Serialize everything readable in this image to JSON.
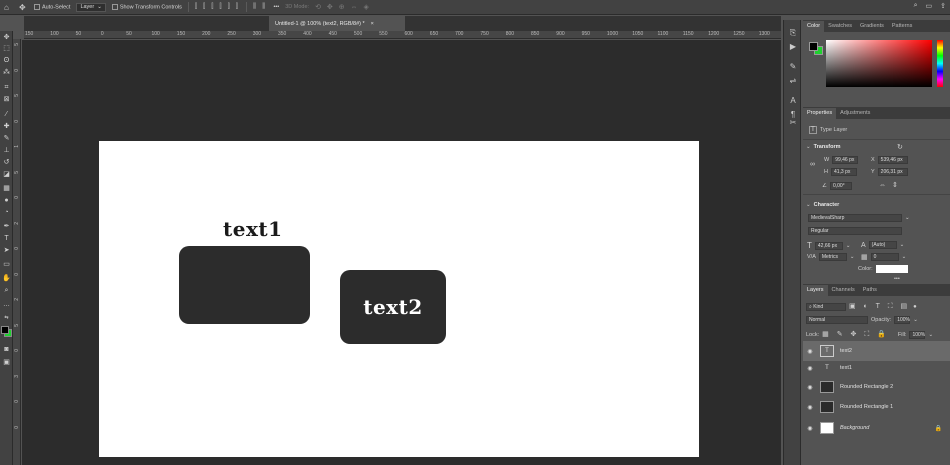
{
  "options_bar": {
    "auto_select_label": "Auto-Select",
    "target_value": "Layer",
    "transform_label": "Show Transform Controls",
    "mode_3d_label": "3D Mode:",
    "more": "•••"
  },
  "document_tab": {
    "title": "Untitled-1 @ 100% (text2, RGB/8#) *",
    "close": "×"
  },
  "ruler_h": [
    "150",
    "100",
    "50",
    "0",
    "50",
    "100",
    "150",
    "200",
    "250",
    "300",
    "350",
    "400",
    "450",
    "500",
    "550",
    "600",
    "650",
    "700",
    "750",
    "800",
    "850",
    "900",
    "950",
    "1000",
    "1050",
    "1100",
    "1150",
    "1200",
    "1250",
    "1300"
  ],
  "ruler_v": [
    "5",
    "0",
    "5",
    "0",
    "1",
    "5",
    "0",
    "2",
    "0",
    "0",
    "2",
    "5",
    "0",
    "3",
    "0",
    "0"
  ],
  "canvas": {
    "text1": "text1",
    "text2": "text2"
  },
  "color_panel": {
    "tabs": [
      "Color",
      "Swatches",
      "Gradients",
      "Patterns"
    ],
    "foreground": "#000000",
    "background": "#1fd12f"
  },
  "properties_panel": {
    "tabs": [
      "Properties",
      "Adjustments"
    ],
    "layer_kind": "Type Layer",
    "transform_title": "Transform",
    "w_label": "W",
    "w_value": "99,46 px",
    "x_label": "X",
    "x_value": "539,46 px",
    "h_label": "H",
    "h_value": "41,3 px",
    "y_label": "Y",
    "y_value": "206,31 px",
    "angle_value": "0,00°",
    "character_title": "Character",
    "font_family": "MedievalSharp",
    "font_style": "Regular",
    "font_size": "42,66 px",
    "leading": "(Auto)",
    "kerning": "Metrics",
    "tracking": "0",
    "color_label": "Color:",
    "more": "•••"
  },
  "layers_panel": {
    "tabs": [
      "Layers",
      "Channels",
      "Paths"
    ],
    "filter_kind": "Kind",
    "blend_mode": "Normal",
    "opacity_label": "Opacity:",
    "opacity_value": "100%",
    "lock_label": "Lock:",
    "fill_label": "Fill:",
    "fill_value": "100%",
    "layers": [
      {
        "name": "text2",
        "type": "text"
      },
      {
        "name": "text1",
        "type": "text"
      },
      {
        "name": "Rounded Rectangle 2",
        "type": "shape"
      },
      {
        "name": "Rounded Rectangle 1",
        "type": "shape"
      },
      {
        "name": "Background",
        "type": "background"
      }
    ]
  }
}
